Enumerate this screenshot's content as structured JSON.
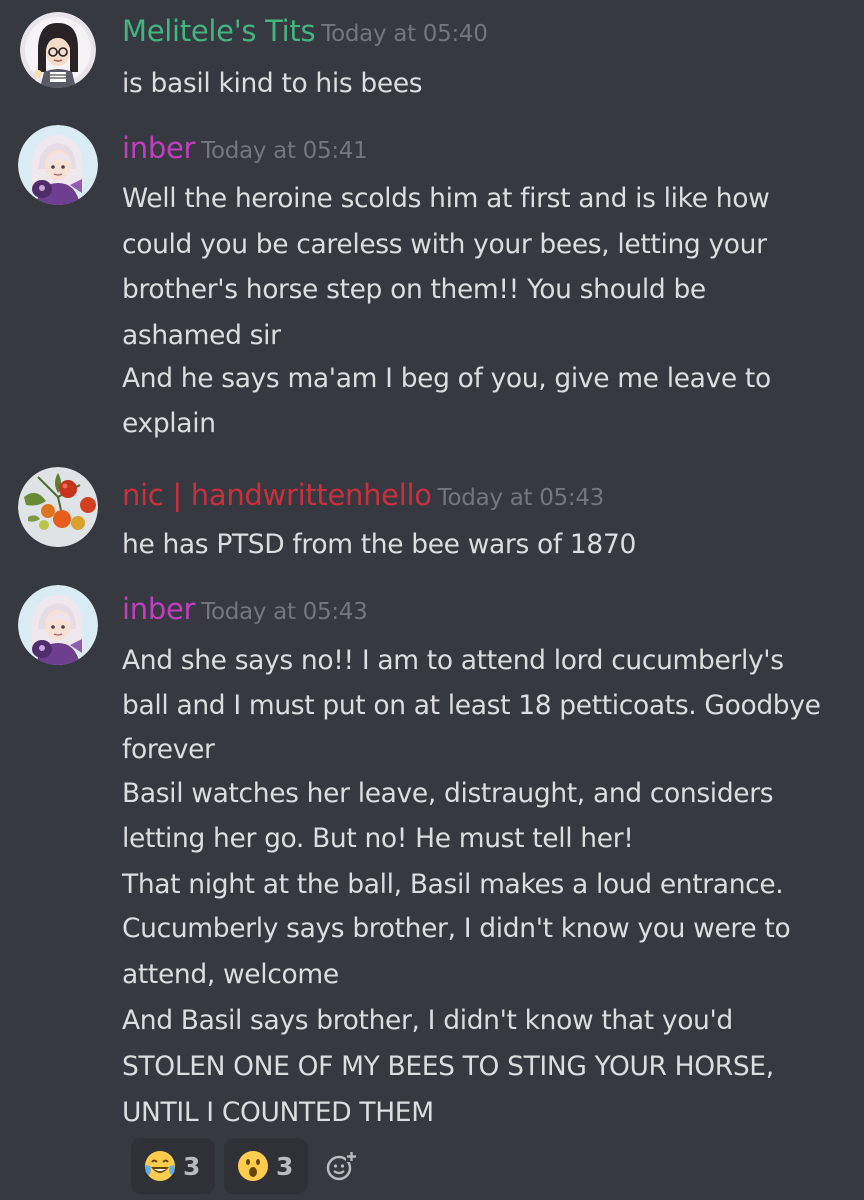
{
  "colors": {
    "background": "#36393f",
    "message_text": "#dcddde",
    "timestamp": "#72767d",
    "reaction_bg": "#2f3136"
  },
  "messages": [
    {
      "username": "Melitele's Tits",
      "username_color": "#43b581",
      "timestamp": "Today at 05:40",
      "avatar_icon": "glasses-character-avatar",
      "lines": [
        "is basil kind to his bees"
      ]
    },
    {
      "username": "inber",
      "username_color": "#c13fbf",
      "timestamp": "Today at 05:41",
      "avatar_icon": "white-haired-character-avatar",
      "lines": [
        "Well the heroine scolds him at first and is like how",
        "could you be careless with your bees, letting your",
        "brother's horse step on them!! You should be",
        "ashamed sir",
        "And he says ma'am I beg of you, give me leave to",
        "explain"
      ]
    },
    {
      "username": "nic | handwrittenhello",
      "username_color": "#c9303e",
      "timestamp": "Today at 05:43",
      "avatar_icon": "tomato-plant-avatar",
      "lines": [
        "he has PTSD from the bee wars of 1870"
      ]
    },
    {
      "username": "inber",
      "username_color": "#c13fbf",
      "timestamp": "Today at 05:43",
      "avatar_icon": "white-haired-character-avatar",
      "lines": [
        "And she says no!! I am to attend lord cucumberly's",
        "ball and I must put on at least 18 petticoats. Goodbye",
        "forever",
        "Basil watches her leave, distraught, and considers",
        "letting her go. But no! He must tell her!",
        "That night at the ball, Basil makes a loud entrance.",
        "Cucumberly says brother, I didn't know you were to",
        "attend, welcome",
        "And Basil says brother, I didn't know that you'd",
        "STOLEN ONE OF MY BEES TO STING YOUR HORSE,",
        "UNTIL I COUNTED THEM"
      ]
    }
  ],
  "reactions": [
    {
      "emoji": "😂",
      "icon": "joy-emoji-icon",
      "count": "3"
    },
    {
      "emoji": "😮",
      "icon": "open-mouth-emoji-icon",
      "count": "3"
    }
  ],
  "add_reaction_icon": "add-reaction-icon"
}
